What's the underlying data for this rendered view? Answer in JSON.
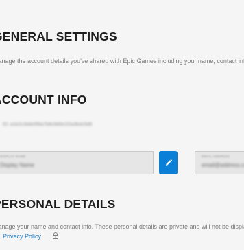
{
  "general_settings": {
    "title": "GENERAL SETTINGS",
    "description": "Manage the account details you've shared with Epic Games including your name, contact info and more."
  },
  "account_info": {
    "title": "ACCOUNT INFO",
    "account_id": "ID: a1b2c3d4e5f6a7b8c9d0e1f2a3b4c5d6",
    "display_name_field": {
      "label": "DISPLAY NAME",
      "value": "Display Name"
    },
    "email_field": {
      "label": "EMAIL ADDRESS",
      "value": "email@address.com"
    },
    "edit_icon": "pencil-icon"
  },
  "personal_details": {
    "title": "PERSONAL DETAILS",
    "description": "Manage your name and contact info. These personal details are private and will not be displayed to other users.",
    "privacy_link": "Privacy Policy",
    "lock_icon": "lock-icon"
  },
  "colors": {
    "accent": "#0a7fd8",
    "link": "#1a78c2",
    "background": "#f5f5f5"
  }
}
